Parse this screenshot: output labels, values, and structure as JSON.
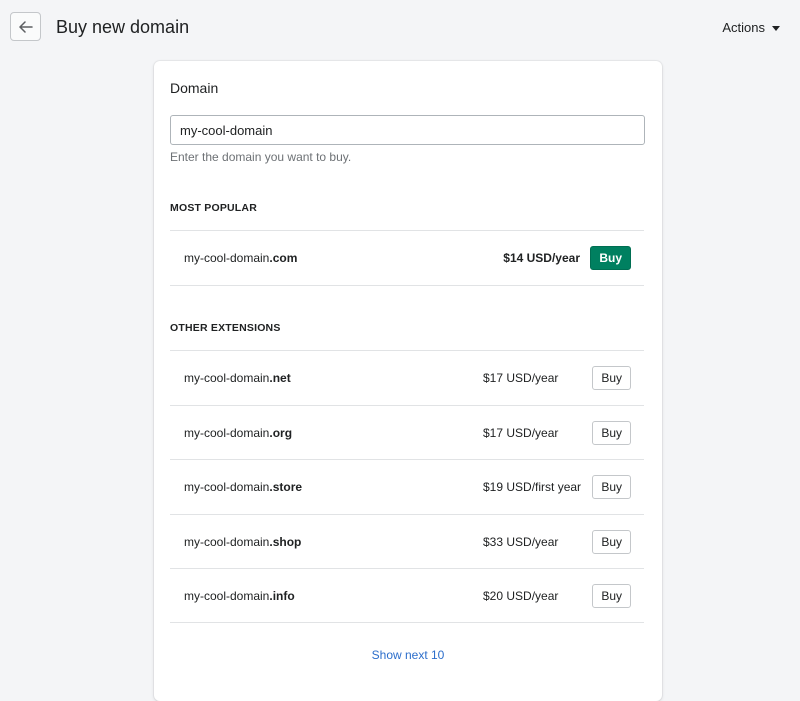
{
  "header": {
    "title": "Buy new domain",
    "actions_label": "Actions"
  },
  "card": {
    "title": "Domain",
    "input": {
      "value": "my-cool-domain",
      "help": "Enter the domain you want to buy."
    },
    "most_popular": {
      "heading": "MOST POPULAR",
      "items": [
        {
          "base": "my-cool-domain",
          "ext": ".com",
          "price": "$14 USD/year",
          "buy_label": "Buy"
        }
      ]
    },
    "other_extensions": {
      "heading": "OTHER EXTENSIONS",
      "items": [
        {
          "base": "my-cool-domain",
          "ext": ".net",
          "price": "$17 USD/year",
          "buy_label": "Buy"
        },
        {
          "base": "my-cool-domain",
          "ext": ".org",
          "price": "$17 USD/year",
          "buy_label": "Buy"
        },
        {
          "base": "my-cool-domain",
          "ext": ".store",
          "price": "$19 USD/first year",
          "buy_label": "Buy"
        },
        {
          "base": "my-cool-domain",
          "ext": ".shop",
          "price": "$33 USD/year",
          "buy_label": "Buy"
        },
        {
          "base": "my-cool-domain",
          "ext": ".info",
          "price": "$20 USD/year",
          "buy_label": "Buy"
        }
      ]
    },
    "show_next_label": "Show next 10"
  },
  "colors": {
    "primary": "#008060",
    "link": "#2c6ecb",
    "background": "#f4f5f7"
  },
  "icons": {
    "back": "arrow-left-icon",
    "actions": "caret-down-icon"
  }
}
